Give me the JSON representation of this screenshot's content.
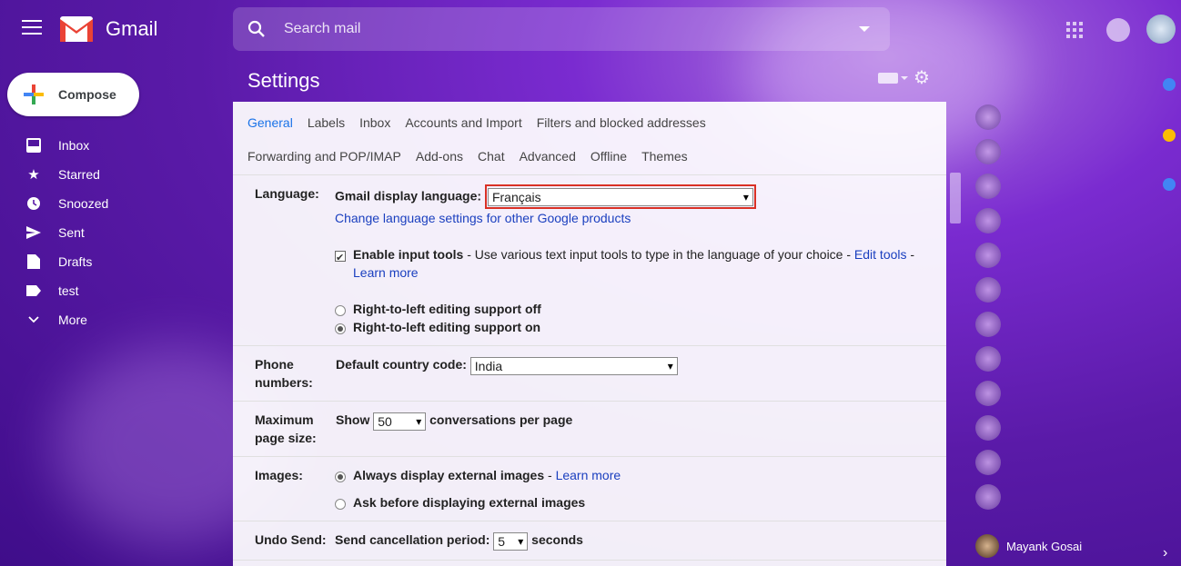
{
  "app": {
    "name": "Gmail"
  },
  "search": {
    "placeholder": "Search mail"
  },
  "compose": {
    "label": "Compose"
  },
  "nav": {
    "items": [
      {
        "label": "Inbox",
        "icon": "inbox-icon"
      },
      {
        "label": "Starred",
        "icon": "star-icon"
      },
      {
        "label": "Snoozed",
        "icon": "clock-icon"
      },
      {
        "label": "Sent",
        "icon": "send-icon"
      },
      {
        "label": "Drafts",
        "icon": "draft-icon"
      },
      {
        "label": "test",
        "icon": "label-icon"
      },
      {
        "label": "More",
        "icon": "chevron-down-icon"
      }
    ]
  },
  "settings": {
    "title": "Settings",
    "tabs_row1": [
      "General",
      "Labels",
      "Inbox",
      "Accounts and Import",
      "Filters and blocked addresses"
    ],
    "tabs_row2": [
      "Forwarding and POP/IMAP",
      "Add-ons",
      "Chat",
      "Advanced",
      "Offline",
      "Themes"
    ],
    "active_tab": "General",
    "language": {
      "label": "Language:",
      "display_label": "Gmail display language:",
      "display_value": "Français",
      "change_link": "Change language settings for other Google products",
      "input_tools_label": "Enable input tools",
      "input_tools_desc": " - Use various text input tools to type in the language of your choice - ",
      "edit_tools": "Edit tools",
      "dash": " -",
      "learn_more": "Learn more",
      "rtl_off": "Right-to-left editing support off",
      "rtl_on": "Right-to-left editing support on"
    },
    "phone": {
      "label_line1": "Phone",
      "label_line2": "numbers:",
      "country_label": "Default country code:",
      "country_value": "India"
    },
    "page_size": {
      "label_line1": "Maximum",
      "label_line2": "page size:",
      "show": "Show",
      "value": "50",
      "suffix": "conversations per page"
    },
    "images": {
      "label": "Images:",
      "always": "Always display external images",
      "sep": " - ",
      "learn_more": "Learn more",
      "ask": "Ask before displaying external images"
    },
    "undo": {
      "label": "Undo Send:",
      "period_label": "Send cancellation period:",
      "value": "5",
      "suffix": "seconds"
    }
  },
  "chat": {
    "current_user": "Mayank Gosai"
  },
  "colors": {
    "accent": "#1a73e8",
    "link": "#1a3fbf",
    "highlight_border": "#d93025"
  }
}
